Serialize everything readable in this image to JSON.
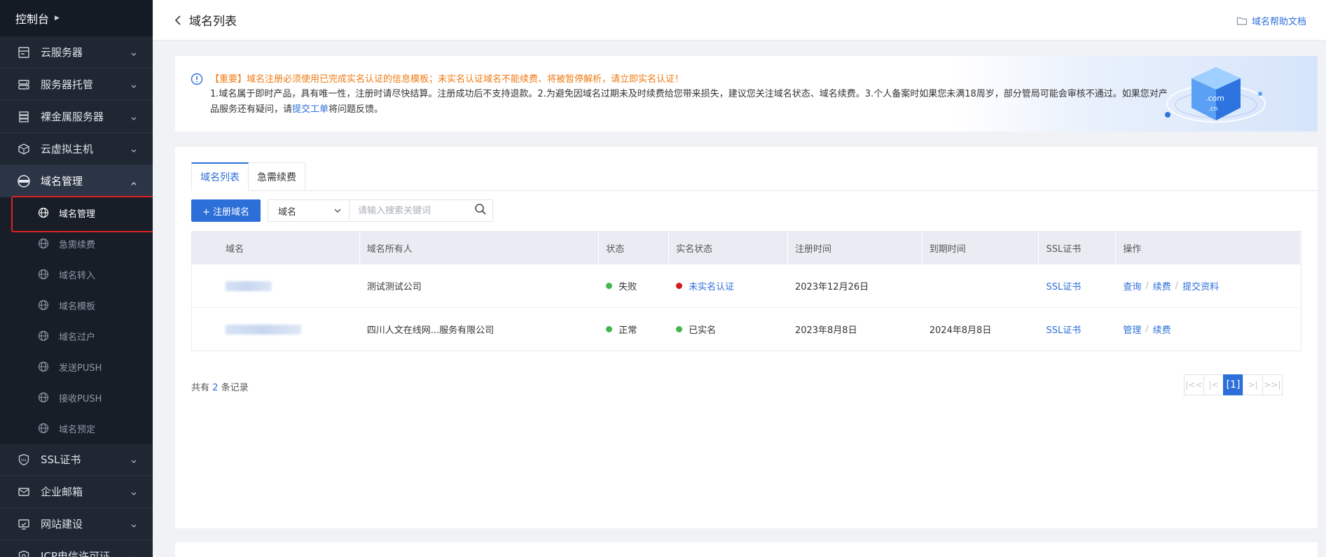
{
  "sidebar": {
    "top_label": "控制台",
    "items": [
      {
        "label": "云服务器",
        "icon": "server-icon"
      },
      {
        "label": "服务器托管",
        "icon": "hosting-icon"
      },
      {
        "label": "裸金属服务器",
        "icon": "bare-metal-icon"
      },
      {
        "label": "云虚拟主机",
        "icon": "cube-icon"
      },
      {
        "label": "域名管理",
        "icon": "www-icon"
      }
    ],
    "domain_sub": [
      {
        "label": "域名管理"
      },
      {
        "label": "急需续费"
      },
      {
        "label": "域名转入"
      },
      {
        "label": "域名模板"
      },
      {
        "label": "域名过户"
      },
      {
        "label": "发送PUSH"
      },
      {
        "label": "接收PUSH"
      },
      {
        "label": "域名预定"
      }
    ],
    "items_after": [
      {
        "label": "SSL证书",
        "icon": "ssl-icon"
      },
      {
        "label": "企业邮箱",
        "icon": "mail-icon"
      },
      {
        "label": "网站建设",
        "icon": "website-icon"
      },
      {
        "label": "ICP电信许可证",
        "icon": "license-icon"
      }
    ]
  },
  "header": {
    "title": "域名列表",
    "help_label": "域名帮助文档"
  },
  "notice": {
    "important": "【重要】域名注册必须使用已完成实名认证的信息模板；未实名认证域名不能续费、将被暂停解析，请立即实名认证！",
    "body_pre": "1.域名属于即时产品，具有唯一性，注册时请尽快结算。注册成功后不支持退款。2.为避免因域名过期未及时续费给您带来损失，建议您关注域名状态、域名续费。3.个人备案时如果您未满18周岁，部分管局可能会审核不通过。如果您对产品服务还有疑问，请",
    "body_link": "提交工单",
    "body_post": "将问题反馈。",
    "banner_text_1": ".com",
    "banner_text_2": ".cn"
  },
  "tabs": [
    {
      "label": "域名列表",
      "active": true
    },
    {
      "label": "急需续费",
      "active": false
    }
  ],
  "toolbar": {
    "register_label": "+ 注册域名",
    "select_value": "域名",
    "search_placeholder": "请输入搜索关键词"
  },
  "table": {
    "columns": [
      "域名",
      "域名所有人",
      "状态",
      "实名状态",
      "注册时间",
      "到期时间",
      "SSL证书",
      "操作"
    ],
    "rows": [
      {
        "owner": "测试测试公司",
        "status": "失败",
        "status_color": "#43b549",
        "realname": "未实名认证",
        "realname_color": "#d4181f",
        "reg_date": "2023年12月26日",
        "exp_date": "",
        "ssl": "SSL证书",
        "actions": [
          "查询",
          "续费",
          "提交资料"
        ]
      },
      {
        "owner": "四川人文在线网...服务有限公司",
        "status": "正常",
        "status_color": "#43b549",
        "realname": "已实名",
        "realname_color": "#43b549",
        "reg_date": "2023年8月8日",
        "exp_date": "2024年8月8日",
        "ssl": "SSL证书",
        "actions": [
          "管理",
          "续费"
        ]
      }
    ]
  },
  "footer": {
    "total_pre": "共有",
    "total_count": "2",
    "total_post": "条记录",
    "current_page": "[1]",
    "pager_first": "|<<",
    "pager_prev": "|<",
    "pager_next": ">|",
    "pager_last": ">>|"
  },
  "colors": {
    "primary": "#2d6fd9",
    "warning": "#f07a12",
    "sidebar_bg": "#1f2733",
    "highlight": "#e02020"
  }
}
